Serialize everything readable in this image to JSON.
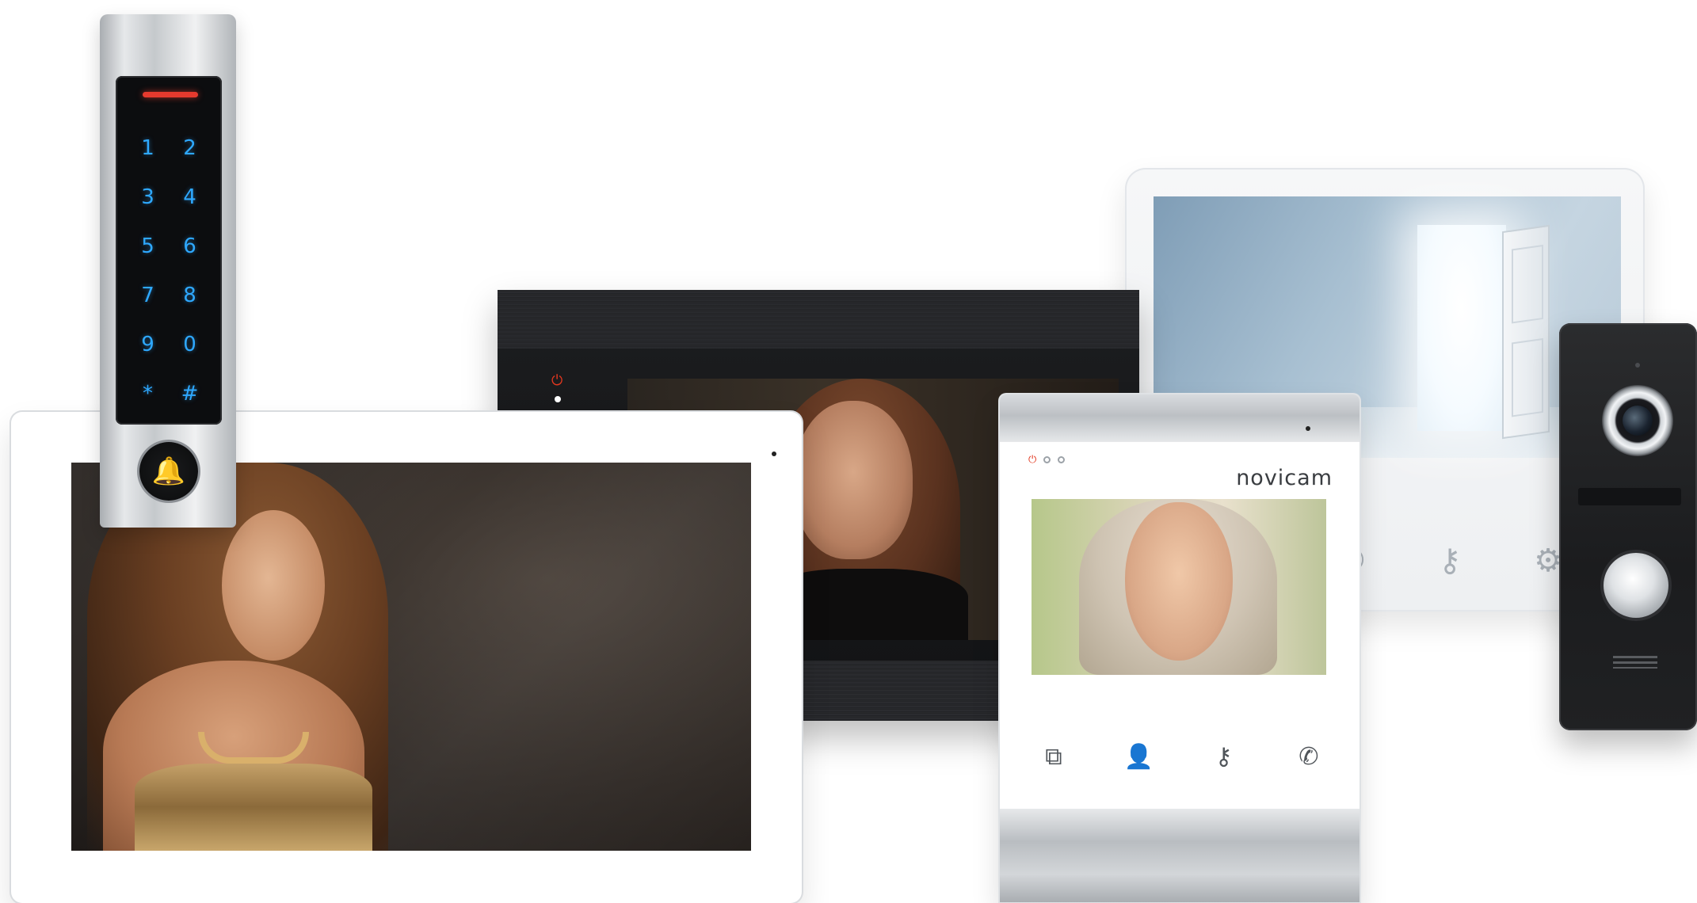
{
  "brand": {
    "name": "novicam"
  },
  "keypad": {
    "keys": [
      "1",
      "2",
      "3",
      "4",
      "5",
      "6",
      "7",
      "8",
      "9",
      "0",
      "*",
      "#"
    ],
    "bell_icon": "bell-icon",
    "key_color": "#2ea8ff",
    "status_bar_color": "#e63a2e"
  },
  "small_monitor": {
    "buttons": [
      {
        "icon": "monitor-switch-icon",
        "glyph": "⧉"
      },
      {
        "icon": "portrait-icon",
        "glyph": "👤"
      },
      {
        "icon": "key-icon",
        "glyph": "⚷"
      },
      {
        "icon": "handset-icon",
        "glyph": "✆"
      }
    ],
    "power_led_color": "#e2371f"
  },
  "white_monitor": {
    "buttons": [
      {
        "icon": "phone-icon",
        "glyph": "✆"
      },
      {
        "icon": "key-icon",
        "glyph": "⚷"
      },
      {
        "icon": "gear-icon",
        "glyph": "⚙"
      }
    ]
  },
  "colors": {
    "background": "#ffffff",
    "black_monitor": "#1b1c1e",
    "silver": "#c5c9cc"
  }
}
